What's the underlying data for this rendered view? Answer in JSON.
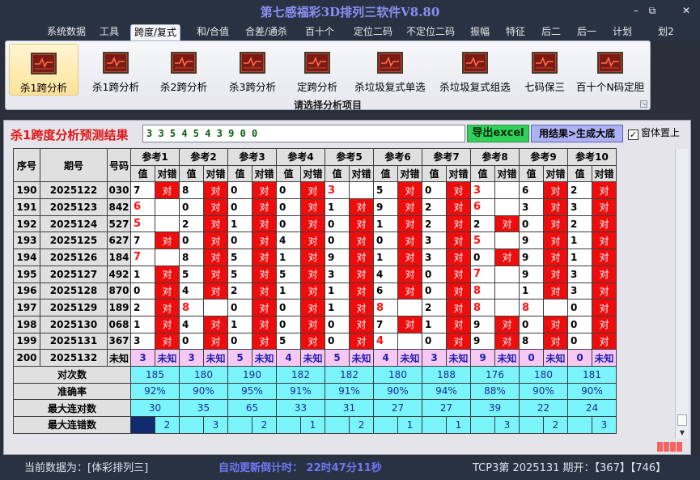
{
  "window": {
    "title": "第七感福彩3D排列三软件V8.80",
    "btn_min": "–",
    "btn_max": "⧉",
    "btn_close": "✕"
  },
  "menu": [
    "系统数据",
    "工具",
    "跨度/复式",
    "和/合值",
    "合差/通杀",
    "百十个",
    "定位二码",
    "不定位二码",
    "振幅",
    "特征",
    "后二",
    "后一",
    "计划",
    "划2"
  ],
  "menu_active": 2,
  "ribbon": {
    "buttons": [
      "杀1跨分析",
      "杀1跨分析",
      "杀2跨分析",
      "杀3跨分析",
      "定跨分析",
      "杀垃圾复式单选",
      "杀垃圾复式组选",
      "七码保三",
      "百十个N码定胆"
    ],
    "selected": 0,
    "caption": "请选择分析项目",
    "icon": "chart-icon"
  },
  "result": {
    "title": "杀1跨度分析预测结果",
    "value": "3 3 5 4 5 4 3 9 0 0",
    "export_label": "导出excel",
    "generate_label": "用结果>生成大底",
    "topmost_label": "窗体置上",
    "topmost_checked": "✓"
  },
  "table": {
    "col_headers": [
      "序号",
      "期号",
      "号码"
    ],
    "refs": [
      "参考1",
      "参考2",
      "参考3",
      "参考4",
      "参考5",
      "参考6",
      "参考7",
      "参考8",
      "参考9",
      "参考10"
    ],
    "sub_value": "值",
    "sub_match": "对错",
    "rows": [
      {
        "seq": "190",
        "period": "2025122",
        "code": "030",
        "v": [
          "7",
          "8",
          "0",
          "0",
          "3",
          "5",
          "0",
          "3",
          "6",
          "2"
        ],
        "hit": [
          1,
          1,
          1,
          1,
          0,
          1,
          1,
          0,
          1,
          1
        ],
        "hi": [
          0,
          0,
          0,
          0,
          1,
          0,
          0,
          1,
          0,
          0
        ]
      },
      {
        "seq": "191",
        "period": "2025123",
        "code": "842",
        "v": [
          "6",
          "0",
          "0",
          "0",
          "1",
          "9",
          "2",
          "6",
          "3",
          "3"
        ],
        "hit": [
          0,
          1,
          1,
          1,
          1,
          1,
          1,
          0,
          1,
          1
        ],
        "hi": [
          1,
          0,
          0,
          0,
          0,
          0,
          0,
          1,
          0,
          0
        ]
      },
      {
        "seq": "192",
        "period": "2025124",
        "code": "527",
        "v": [
          "5",
          "2",
          "1",
          "0",
          "0",
          "1",
          "2",
          "2",
          "0",
          "2"
        ],
        "hit": [
          0,
          1,
          1,
          1,
          1,
          1,
          1,
          1,
          1,
          1
        ],
        "hi": [
          1,
          0,
          0,
          0,
          0,
          0,
          0,
          0,
          0,
          0
        ]
      },
      {
        "seq": "193",
        "period": "2025125",
        "code": "627",
        "v": [
          "7",
          "0",
          "0",
          "4",
          "0",
          "0",
          "3",
          "5",
          "9",
          "1"
        ],
        "hit": [
          1,
          1,
          1,
          1,
          1,
          1,
          1,
          0,
          1,
          1
        ],
        "hi": [
          0,
          0,
          0,
          0,
          0,
          0,
          0,
          1,
          0,
          0
        ]
      },
      {
        "seq": "194",
        "period": "2025126",
        "code": "184",
        "v": [
          "7",
          "8",
          "5",
          "1",
          "9",
          "1",
          "3",
          "0",
          "9",
          "1"
        ],
        "hit": [
          0,
          1,
          1,
          1,
          1,
          1,
          1,
          1,
          1,
          1
        ],
        "hi": [
          1,
          0,
          0,
          0,
          0,
          0,
          0,
          0,
          0,
          0
        ]
      },
      {
        "seq": "195",
        "period": "2025127",
        "code": "492",
        "v": [
          "1",
          "5",
          "5",
          "5",
          "3",
          "4",
          "0",
          "7",
          "9",
          "3"
        ],
        "hit": [
          1,
          1,
          1,
          1,
          1,
          1,
          1,
          0,
          1,
          1
        ],
        "hi": [
          0,
          0,
          0,
          0,
          0,
          0,
          0,
          1,
          0,
          0
        ]
      },
      {
        "seq": "196",
        "period": "2025128",
        "code": "870",
        "v": [
          "0",
          "4",
          "2",
          "1",
          "1",
          "6",
          "0",
          "8",
          "1",
          "3"
        ],
        "hit": [
          1,
          1,
          1,
          1,
          1,
          1,
          1,
          0,
          1,
          1
        ],
        "hi": [
          0,
          0,
          0,
          0,
          0,
          0,
          0,
          1,
          0,
          0
        ]
      },
      {
        "seq": "197",
        "period": "2025129",
        "code": "189",
        "v": [
          "2",
          "8",
          "0",
          "0",
          "1",
          "8",
          "2",
          "8",
          "8",
          "0"
        ],
        "hit": [
          1,
          0,
          1,
          1,
          1,
          0,
          1,
          0,
          0,
          1
        ],
        "hi": [
          0,
          1,
          0,
          0,
          0,
          1,
          0,
          1,
          1,
          0
        ]
      },
      {
        "seq": "198",
        "period": "2025130",
        "code": "068",
        "v": [
          "1",
          "4",
          "1",
          "0",
          "0",
          "7",
          "1",
          "9",
          "0",
          "0"
        ],
        "hit": [
          1,
          1,
          1,
          1,
          1,
          1,
          1,
          1,
          1,
          1
        ],
        "hi": [
          0,
          0,
          0,
          0,
          0,
          0,
          0,
          0,
          0,
          0
        ]
      },
      {
        "seq": "199",
        "period": "2025131",
        "code": "367",
        "v": [
          "3",
          "0",
          "0",
          "5",
          "0",
          "4",
          "0",
          "9",
          "8",
          "0"
        ],
        "hit": [
          1,
          1,
          1,
          1,
          1,
          0,
          1,
          1,
          1,
          1
        ],
        "hi": [
          0,
          0,
          0,
          0,
          0,
          1,
          0,
          0,
          0,
          0
        ]
      }
    ],
    "pending": {
      "seq": "200",
      "period": "2025132",
      "code": "未知",
      "v": [
        "3",
        "3",
        "5",
        "4",
        "5",
        "4",
        "3",
        "9",
        "0",
        "0"
      ],
      "m": "未知"
    },
    "stats": [
      {
        "label": "对次数",
        "vals": [
          "185",
          "180",
          "190",
          "182",
          "182",
          "180",
          "188",
          "176",
          "180",
          "181"
        ]
      },
      {
        "label": "准确率",
        "vals": [
          "92%",
          "90%",
          "95%",
          "91%",
          "91%",
          "90%",
          "94%",
          "88%",
          "90%",
          "90%"
        ]
      },
      {
        "label": "最大连对数",
        "vals": [
          "30",
          "35",
          "65",
          "33",
          "31",
          "27",
          "27",
          "39",
          "22",
          "24"
        ]
      },
      {
        "label": "最大连错数",
        "vals": [
          "2",
          "3",
          "2",
          "1",
          "2",
          "1",
          "1",
          "3",
          "2",
          "3"
        ]
      }
    ],
    "hit_text": "对"
  },
  "status": {
    "current": "当前数据为：[体彩排列三]",
    "countdown": "自动更新倒计时： 22时47分11秒",
    "open": "TCP3第 2025131 期开：【367】【746】"
  }
}
